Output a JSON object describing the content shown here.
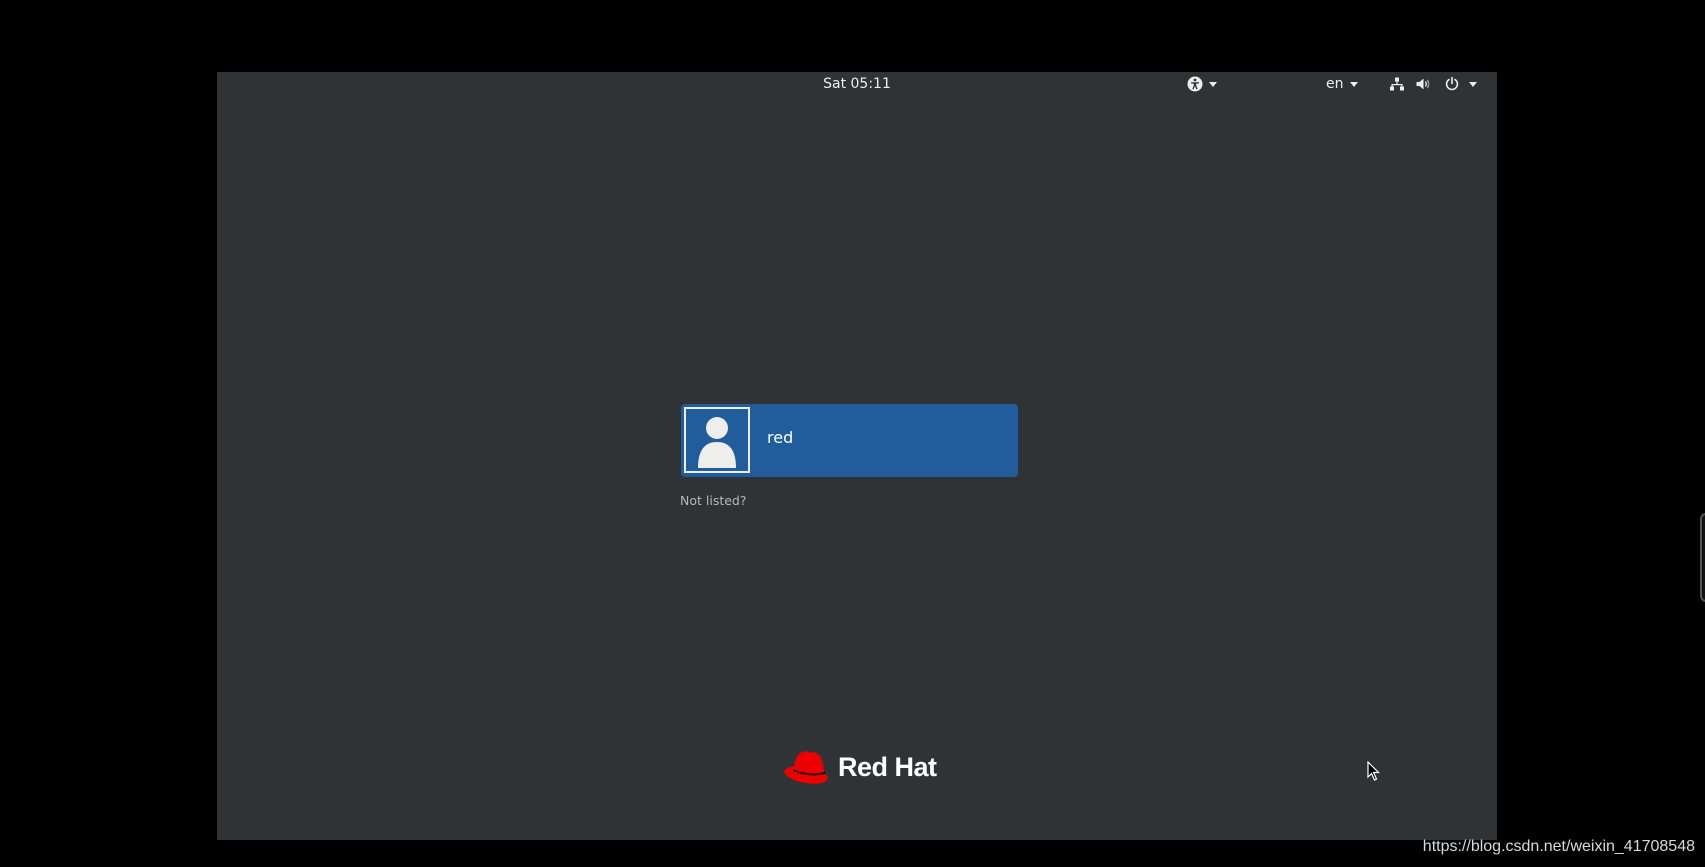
{
  "topbar": {
    "clock": "Sat 05:11",
    "language": "en"
  },
  "icons": {
    "accessibility": "accessibility-icon",
    "network": "network-wired-icon",
    "volume": "volume-icon",
    "power": "power-icon"
  },
  "login": {
    "user_name": "red",
    "not_listed": "Not listed?"
  },
  "brand": {
    "logo_text": "Red Hat",
    "logo_color": "#ee0000"
  },
  "colors": {
    "background": "#2f3336",
    "user_card": "#215d9c"
  },
  "watermark": "https://blog.csdn.net/weixin_41708548"
}
